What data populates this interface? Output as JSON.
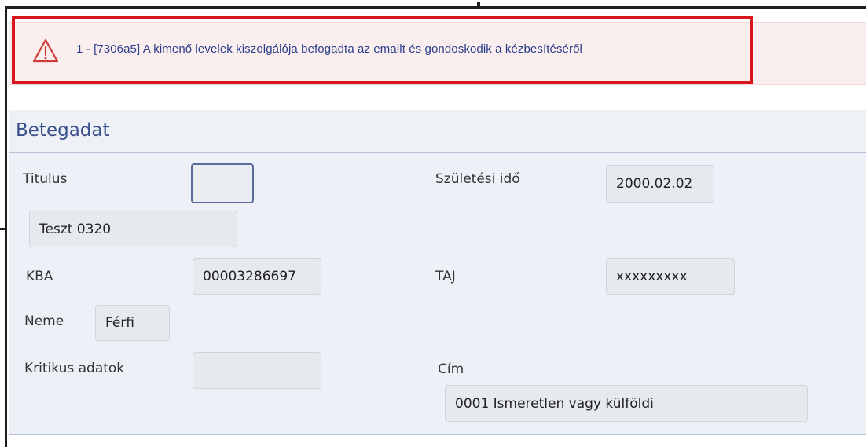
{
  "alert": {
    "icon": "warning-triangle-icon",
    "message": "1 - [7306a5] A kimenő levelek kiszolgálója befogadta az emailt és gondoskodik a kézbesítéséről",
    "accent_color": "#d9161c"
  },
  "panel": {
    "title": "Betegadat"
  },
  "fields": {
    "titulus": {
      "label": "Titulus",
      "value": ""
    },
    "name": {
      "value": "Teszt 0320"
    },
    "kba": {
      "label": "KBA",
      "value": "00003286697"
    },
    "neme": {
      "label": "Neme",
      "value": "Férfi"
    },
    "kritikus": {
      "label": "Kritikus adatok",
      "value": ""
    },
    "szuletesi": {
      "label": "Születési idő",
      "value": "2000.02.02"
    },
    "taj": {
      "label": "TAJ",
      "value": "xxxxxxxxx"
    },
    "cim": {
      "label": "Cím",
      "value": "0001 Ismeretlen vagy külföldi"
    }
  }
}
